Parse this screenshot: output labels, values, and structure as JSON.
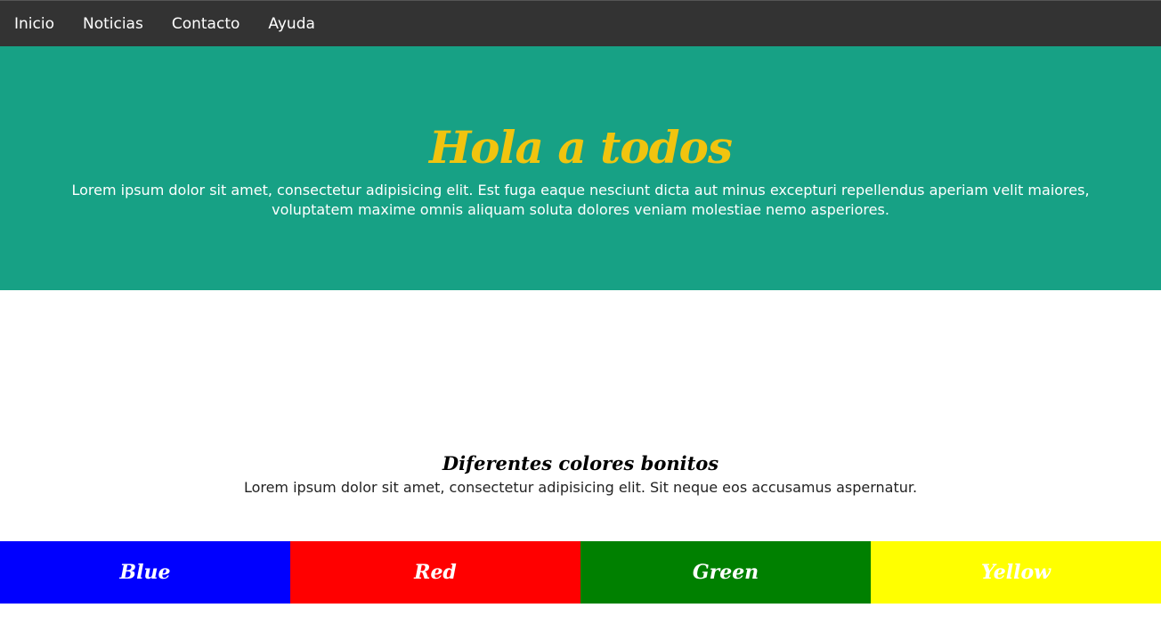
{
  "nav": {
    "items": [
      {
        "label": "Inicio"
      },
      {
        "label": "Noticias"
      },
      {
        "label": "Contacto"
      },
      {
        "label": "Ayuda"
      }
    ]
  },
  "hero": {
    "title": "Hola a todos",
    "text": "Lorem ipsum dolor sit amet, consectetur adipisicing elit. Est fuga eaque nesciunt dicta aut minus excepturi repellendus aperiam velit maiores, voluptatem maxime omnis aliquam soluta dolores veniam molestiae nemo asperiores."
  },
  "section": {
    "title": "Diferentes colores bonitos",
    "text": "Lorem ipsum dolor sit amet, consectetur adipisicing elit. Sit neque eos accusamus aspernatur."
  },
  "colors": [
    {
      "label": "Blue",
      "color": "#0000ff"
    },
    {
      "label": "Red",
      "color": "#ff0000"
    },
    {
      "label": "Green",
      "color": "#008000"
    },
    {
      "label": "Yellow",
      "color": "#ffff00"
    }
  ],
  "theme": {
    "nav_bg": "#333333",
    "hero_bg": "#17a185",
    "hero_title_color": "#f1c40f"
  }
}
